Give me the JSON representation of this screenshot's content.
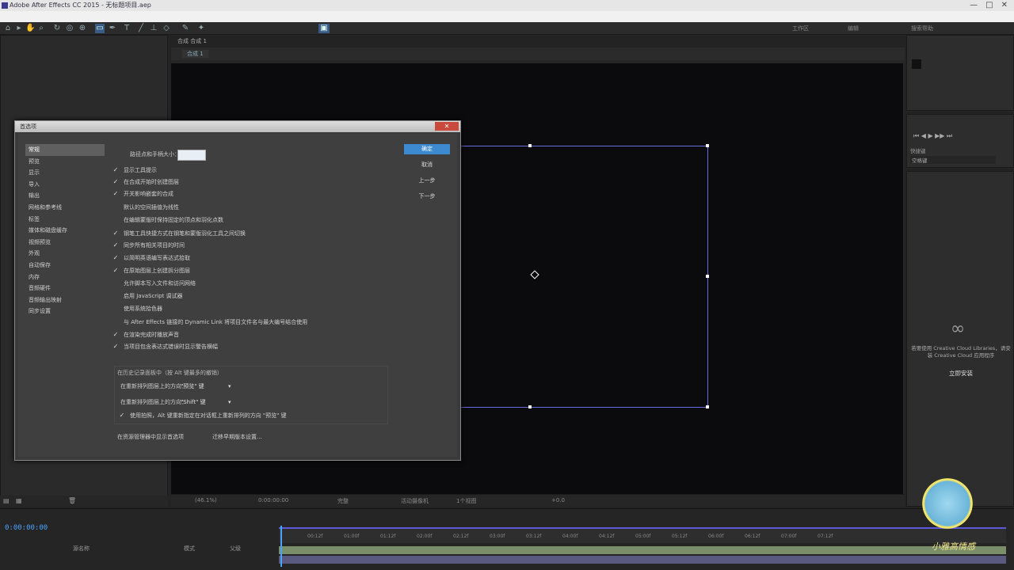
{
  "window": {
    "title": "Adobe After Effects CC 2015 - 无标题项目.aep",
    "controls": [
      "—",
      "□",
      "✕"
    ]
  },
  "toolbar": {
    "tools": [
      "home-icon",
      "selection-icon",
      "hand-icon",
      "zoom-icon",
      "rotate-icon",
      "camera-icon",
      "pan-icon",
      "rect-icon",
      "pen-icon",
      "text-icon",
      "brush-icon",
      "clone-icon",
      "eraser-icon",
      "roto-icon",
      "puppet-icon"
    ],
    "right": [
      "工作区",
      "编辑",
      "搜索帮助"
    ]
  },
  "comp": {
    "tab": "合成 合成 1",
    "subtab": "合成 1",
    "zoom": "(46.1%)",
    "timecode": "0:00:00:00",
    "view": "完整",
    "camera": "活动摄像机",
    "views": "1个视图",
    "offset": "+0.0"
  },
  "right_panel": {
    "preview": "预览",
    "shortcut": "快捷键",
    "space": "空格键",
    "cc_text": "若要使用 Creative Cloud Libraries，请安装 Creative Cloud 应用程序",
    "cc_link": "立即安装"
  },
  "timeline": {
    "timecode": "0:00:00:00",
    "layer_col": "源名称",
    "mode_col": "模式",
    "parent_col": "父级",
    "ticks": [
      "00:12f",
      "01:00f",
      "01:12f",
      "02:00f",
      "02:12f",
      "03:00f",
      "03:12f",
      "04:00f",
      "04:12f",
      "05:00f",
      "05:12f",
      "06:00f",
      "06:12f",
      "07:00f",
      "07:12f"
    ]
  },
  "logo_text": "小雅高情感",
  "dialog": {
    "title": "首选项",
    "categories": [
      "常规",
      "预览",
      "显示",
      "导入",
      "输出",
      "网格和参考线",
      "标签",
      "媒体和磁盘缓存",
      "视频预览",
      "外观",
      "自动保存",
      "内存",
      "音频硬件",
      "音频输出映射",
      "同步设置"
    ],
    "selected_category": 0,
    "path_points_label": "路径点和手柄大小：",
    "path_points_value": "",
    "options": [
      {
        "label": "显示工具提示",
        "checked": true
      },
      {
        "label": "在合成开始时创建图层",
        "checked": true
      },
      {
        "label": "开关影响嵌套的合成",
        "checked": true
      },
      {
        "label": "默认的空间插值为线性",
        "checked": false
      },
      {
        "label": "在编辑蒙版时保持固定的顶点和羽化点数",
        "checked": false
      },
      {
        "label": "钢笔工具快捷方式在钢笔和蒙版羽化工具之间切换",
        "checked": true
      },
      {
        "label": "同步所有相关项目的时间",
        "checked": true
      },
      {
        "label": "以简明英语编写表达式拾取",
        "checked": true
      },
      {
        "label": "在原始图层上创建拆分图层",
        "checked": true
      },
      {
        "label": "允许脚本写入文件和访问网络",
        "checked": false
      },
      {
        "label": "启用 JavaScript 调试器",
        "checked": false
      },
      {
        "label": "使用系统拾色器",
        "checked": false
      },
      {
        "label": "与 After Effects 链接的 Dynamic Link 将项目文件名与最大编号结合使用",
        "checked": false
      },
      {
        "label": "在渲染完成时播放声音",
        "checked": true
      },
      {
        "label": "当项目包含表达式错误时显示警告横幅",
        "checked": true
      }
    ],
    "buttons": [
      "确定",
      "取消",
      "上一步",
      "下一步"
    ],
    "undo": {
      "title": "在历史记录面板中（按 Alt 键最多的撤销）",
      "row1_label": "在重新排列图层上的方向：",
      "row1_value": "\"预览\" 键",
      "row2_label": "在重新排列图层上的方向：",
      "row2_value": "\"Shift\" 键",
      "row3_label": "使用拍照，Alt 键重新指定在对话框上重新排列的方向 \"预览\" 键"
    },
    "bottom_buttons": [
      "在资源管理器中显示首选项",
      "迁移早期版本设置..."
    ]
  }
}
